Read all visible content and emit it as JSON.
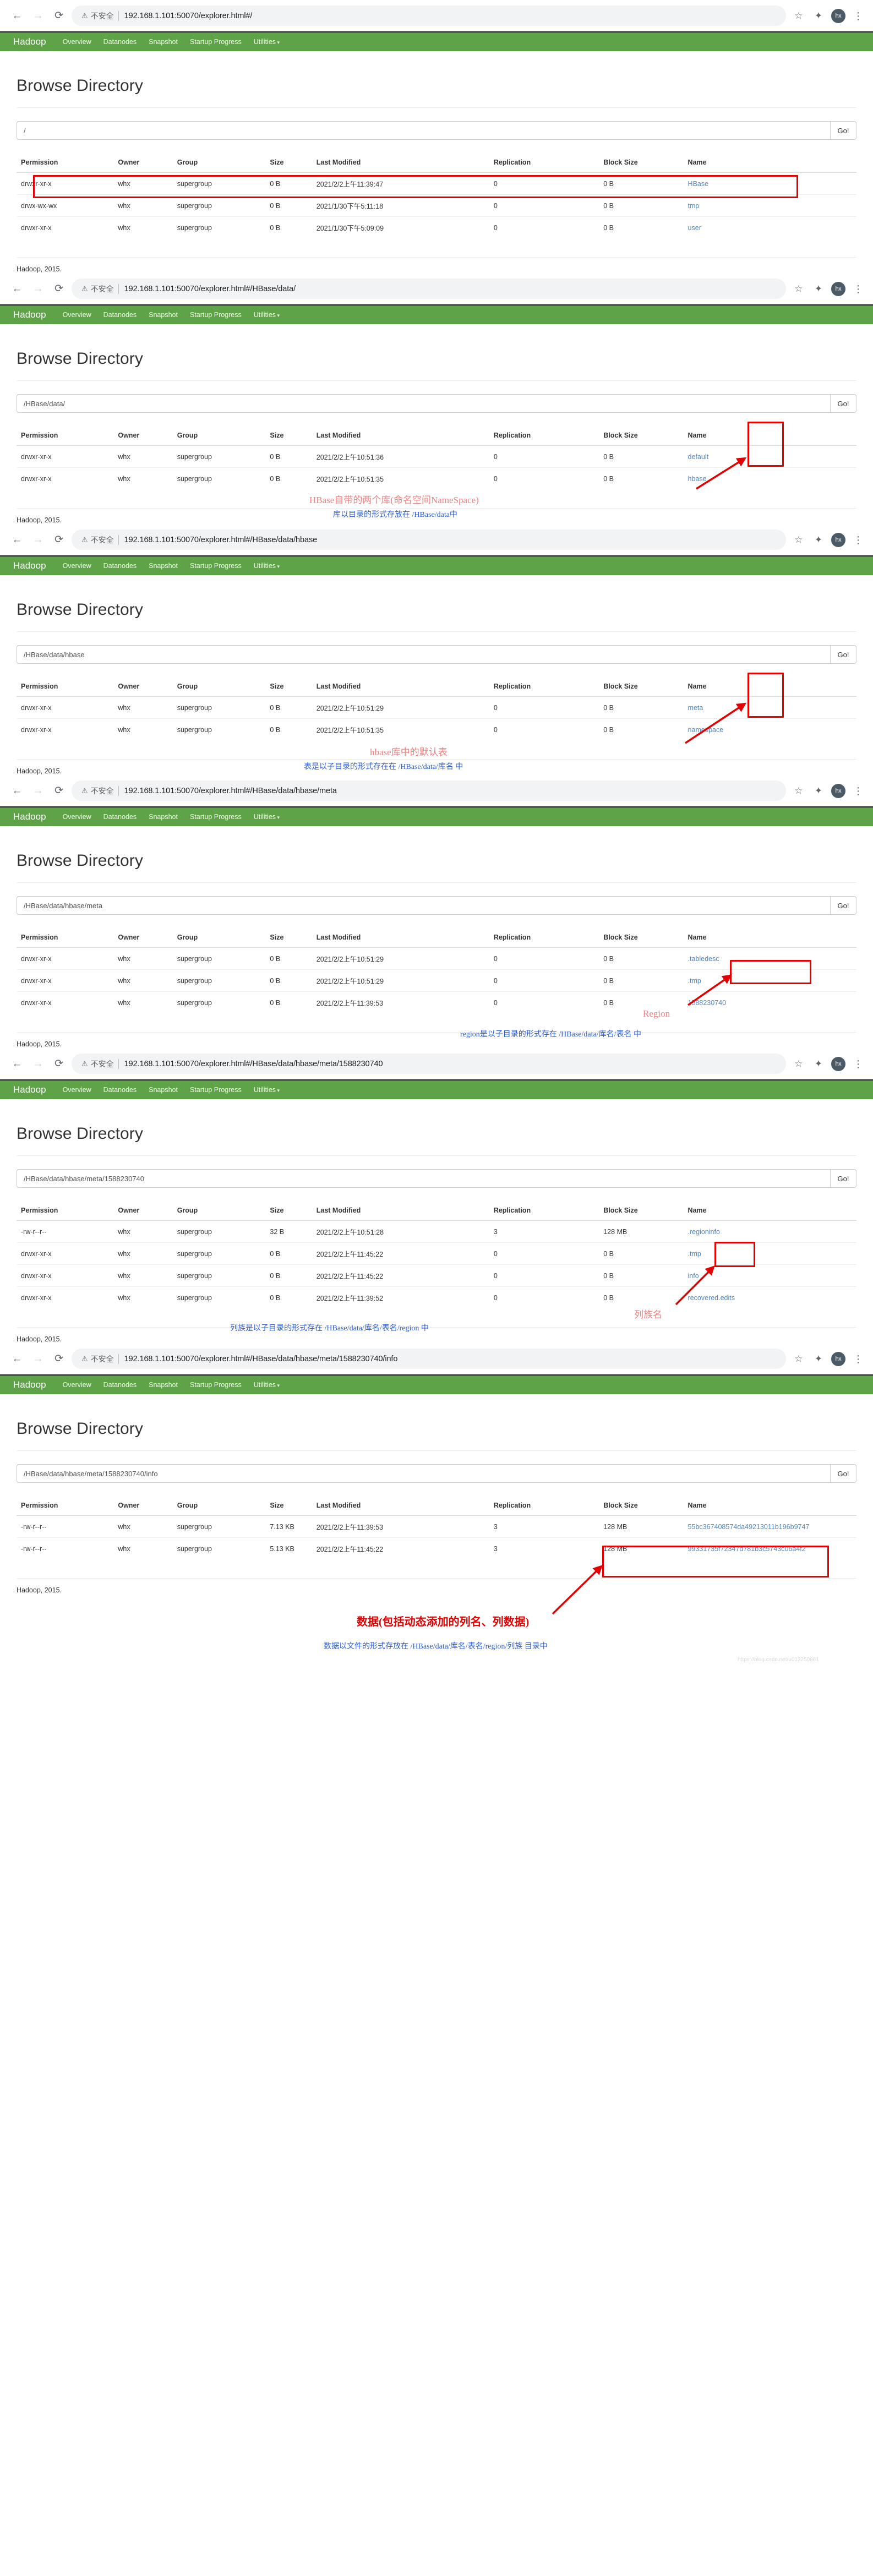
{
  "browser": {
    "back_icon": "←",
    "forward_icon": "→",
    "reload_icon": "⟳",
    "warning_icon": "⚠",
    "insecure_label": "不安全",
    "star_icon": "☆",
    "extension_icon": "✦",
    "avatar_label": "hx",
    "menu_icon": "⋮"
  },
  "hadoop_nav": {
    "brand": "Hadoop",
    "links": [
      {
        "label": "Overview",
        "caret": false
      },
      {
        "label": "Datanodes",
        "caret": false
      },
      {
        "label": "Snapshot",
        "caret": false
      },
      {
        "label": "Startup Progress",
        "caret": false
      },
      {
        "label": "Utilities",
        "caret": true
      }
    ]
  },
  "common": {
    "page_title": "Browse Directory",
    "go_label": "Go!",
    "footer": "Hadoop, 2015.",
    "columns": [
      "Permission",
      "Owner",
      "Group",
      "Size",
      "Last Modified",
      "Replication",
      "Block Size",
      "Name"
    ],
    "watermark": "https://blog.csdn.net/u013250861"
  },
  "sections": [
    {
      "url": "192.168.1.101:50070/explorer.html#/",
      "path_value": "/",
      "rows": [
        {
          "permission": "drwxr-xr-x",
          "owner": "whx",
          "group": "supergroup",
          "size": "0 B",
          "modified": "2021/2/2上午11:39:47",
          "replication": "0",
          "block_size": "0 B",
          "name": "HBase"
        },
        {
          "permission": "drwx-wx-wx",
          "owner": "whx",
          "group": "supergroup",
          "size": "0 B",
          "modified": "2021/1/30下午5:11:18",
          "replication": "0",
          "block_size": "0 B",
          "name": "tmp"
        },
        {
          "permission": "drwxr-xr-x",
          "owner": "whx",
          "group": "supergroup",
          "size": "0 B",
          "modified": "2021/1/30下午5:09:09",
          "replication": "0",
          "block_size": "0 B",
          "name": "user"
        }
      ],
      "annotations": []
    },
    {
      "url": "192.168.1.101:50070/explorer.html#/HBase/data/",
      "path_value": "/HBase/data/",
      "rows": [
        {
          "permission": "drwxr-xr-x",
          "owner": "whx",
          "group": "supergroup",
          "size": "0 B",
          "modified": "2021/2/2上午10:51:36",
          "replication": "0",
          "block_size": "0 B",
          "name": "default"
        },
        {
          "permission": "drwxr-xr-x",
          "owner": "whx",
          "group": "supergroup",
          "size": "0 B",
          "modified": "2021/2/2上午10:51:35",
          "replication": "0",
          "block_size": "0 B",
          "name": "hbase"
        }
      ],
      "annotations": [
        {
          "kind": "text-red",
          "text": "HBase自带的两个库(命名空间NameSpace)"
        },
        {
          "kind": "text-blue",
          "text": "库以目录的形式存放在 /HBase/data中"
        }
      ]
    },
    {
      "url": "192.168.1.101:50070/explorer.html#/HBase/data/hbase",
      "path_value": "/HBase/data/hbase",
      "rows": [
        {
          "permission": "drwxr-xr-x",
          "owner": "whx",
          "group": "supergroup",
          "size": "0 B",
          "modified": "2021/2/2上午10:51:29",
          "replication": "0",
          "block_size": "0 B",
          "name": "meta"
        },
        {
          "permission": "drwxr-xr-x",
          "owner": "whx",
          "group": "supergroup",
          "size": "0 B",
          "modified": "2021/2/2上午10:51:35",
          "replication": "0",
          "block_size": "0 B",
          "name": "namespace"
        }
      ],
      "annotations": [
        {
          "kind": "text-red",
          "text": "hbase库中的默认表"
        },
        {
          "kind": "text-blue",
          "text": "表是以子目录的形式存在在 /HBase/data/库名 中"
        }
      ]
    },
    {
      "url": "192.168.1.101:50070/explorer.html#/HBase/data/hbase/meta",
      "path_value": "/HBase/data/hbase/meta",
      "rows": [
        {
          "permission": "drwxr-xr-x",
          "owner": "whx",
          "group": "supergroup",
          "size": "0 B",
          "modified": "2021/2/2上午10:51:29",
          "replication": "0",
          "block_size": "0 B",
          "name": ".tabledesc"
        },
        {
          "permission": "drwxr-xr-x",
          "owner": "whx",
          "group": "supergroup",
          "size": "0 B",
          "modified": "2021/2/2上午10:51:29",
          "replication": "0",
          "block_size": "0 B",
          "name": ".tmp"
        },
        {
          "permission": "drwxr-xr-x",
          "owner": "whx",
          "group": "supergroup",
          "size": "0 B",
          "modified": "2021/2/2上午11:39:53",
          "replication": "0",
          "block_size": "0 B",
          "name": "1588230740"
        }
      ],
      "annotations": [
        {
          "kind": "text-red",
          "text": "Region"
        },
        {
          "kind": "text-blue",
          "text": "region是以子目录的形式存在  /HBase/data/库名/表名 中"
        }
      ]
    },
    {
      "url": "192.168.1.101:50070/explorer.html#/HBase/data/hbase/meta/1588230740",
      "path_value": "/HBase/data/hbase/meta/1588230740",
      "rows": [
        {
          "permission": "-rw-r--r--",
          "owner": "whx",
          "group": "supergroup",
          "size": "32 B",
          "modified": "2021/2/2上午10:51:28",
          "replication": "3",
          "block_size": "128 MB",
          "name": ".regioninfo"
        },
        {
          "permission": "drwxr-xr-x",
          "owner": "whx",
          "group": "supergroup",
          "size": "0 B",
          "modified": "2021/2/2上午11:45:22",
          "replication": "0",
          "block_size": "0 B",
          "name": ".tmp"
        },
        {
          "permission": "drwxr-xr-x",
          "owner": "whx",
          "group": "supergroup",
          "size": "0 B",
          "modified": "2021/2/2上午11:45:22",
          "replication": "0",
          "block_size": "0 B",
          "name": "info"
        },
        {
          "permission": "drwxr-xr-x",
          "owner": "whx",
          "group": "supergroup",
          "size": "0 B",
          "modified": "2021/2/2上午11:39:52",
          "replication": "0",
          "block_size": "0 B",
          "name": "recovered.edits"
        }
      ],
      "annotations": [
        {
          "kind": "text-red",
          "text": "列族名"
        },
        {
          "kind": "text-blue",
          "text": "列族是以子目录的形式存在  /HBase/data/库名/表名/region 中"
        }
      ]
    },
    {
      "url": "192.168.1.101:50070/explorer.html#/HBase/data/hbase/meta/1588230740/info",
      "path_value": "/HBase/data/hbase/meta/1588230740/info",
      "rows": [
        {
          "permission": "-rw-r--r--",
          "owner": "whx",
          "group": "supergroup",
          "size": "7.13 KB",
          "modified": "2021/2/2上午11:39:53",
          "replication": "3",
          "block_size": "128 MB",
          "name": "55bc367408574da49213011b196b9747"
        },
        {
          "permission": "-rw-r--r--",
          "owner": "whx",
          "group": "supergroup",
          "size": "5.13 KB",
          "modified": "2021/2/2上午11:45:22",
          "replication": "3",
          "block_size": "128 MB",
          "name": "99331735f72347d781b3c5743c06a4f2"
        }
      ],
      "annotations": [
        {
          "kind": "text-red-strong",
          "text": "数据(包括动态添加的列名、列数据)"
        },
        {
          "kind": "text-blue",
          "text": "数据以文件的形式存放在  /HBase/data/库名/表名/region/列族 目录中"
        }
      ]
    }
  ]
}
